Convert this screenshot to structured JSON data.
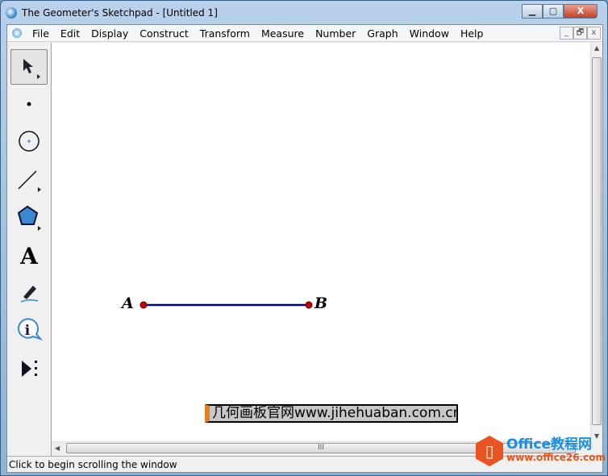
{
  "window": {
    "title": "The Geometer's Sketchpad - [Untitled 1]",
    "minimize": "▁",
    "maximize": "▢",
    "close": "X"
  },
  "menubar": {
    "items": [
      "File",
      "Edit",
      "Display",
      "Construct",
      "Transform",
      "Measure",
      "Number",
      "Graph",
      "Window",
      "Help"
    ],
    "mdi": [
      "_",
      "🗗",
      "x"
    ]
  },
  "toolbox": {
    "tools": [
      "arrow-tool",
      "point-tool",
      "compass-tool",
      "straightedge-tool",
      "polygon-tool",
      "text-tool",
      "marker-tool",
      "information-tool",
      "custom-tool"
    ],
    "text_tool_glyph": "A",
    "info_glyph": "i",
    "selected": "arrow-tool"
  },
  "sketch": {
    "points": [
      {
        "label": "A"
      },
      {
        "label": "B"
      }
    ],
    "segment_color": "#000080",
    "point_color": "#cc0000"
  },
  "watermark": {
    "text": "几何画板官网www.jihehuaban.com.cn"
  },
  "scrollbar": {
    "grip": "III"
  },
  "status": {
    "text": "Click to begin scrolling the window"
  },
  "logo": {
    "brand": "Office教程网",
    "url": "www.office26.com"
  }
}
